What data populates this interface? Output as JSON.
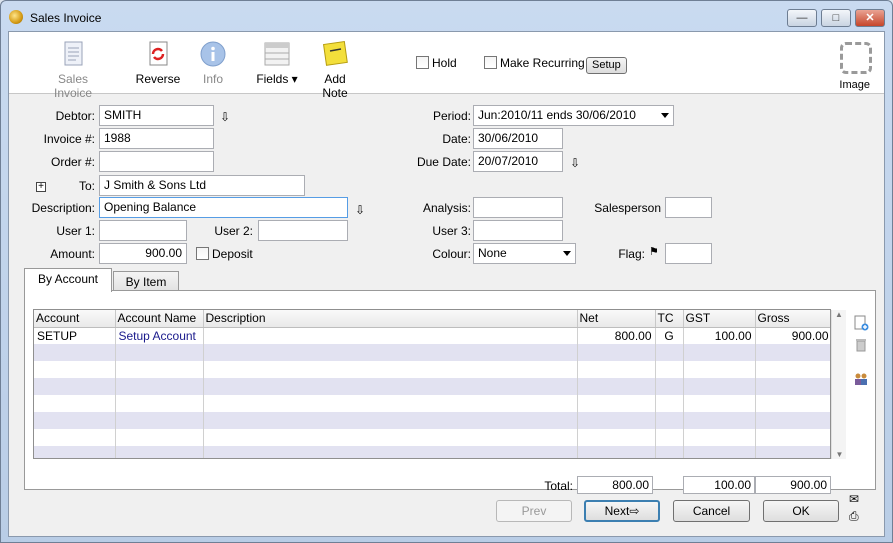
{
  "window": {
    "title": "Sales Invoice"
  },
  "toolbar": {
    "sales_invoice": "Sales Invoice",
    "reverse": "Reverse",
    "info": "Info",
    "fields": "Fields",
    "add_note": "Add Note",
    "hold": "Hold",
    "make_recurring": "Make Recurring",
    "setup": "Setup",
    "image": "Image"
  },
  "form": {
    "debtor_label": "Debtor:",
    "debtor": "SMITH",
    "invoice_label": "Invoice #:",
    "invoice": "1988",
    "order_label": "Order #:",
    "order": "",
    "to_label": "To:",
    "to": "J Smith & Sons Ltd",
    "description_label": "Description:",
    "description": "Opening Balance",
    "user1_label": "User 1:",
    "user1": "",
    "user2_label": "User 2:",
    "user2": "",
    "amount_label": "Amount:",
    "amount": "900.00",
    "deposit_label": "Deposit",
    "period_label": "Period:",
    "period": "Jun:2010/11 ends 30/06/2010",
    "date_label": "Date:",
    "date": "30/06/2010",
    "due_date_label": "Due Date:",
    "due_date": "20/07/2010",
    "analysis_label": "Analysis:",
    "analysis": "",
    "user3_label": "User 3:",
    "user3": "",
    "colour_label": "Colour:",
    "colour": "None",
    "salesperson_label": "Salesperson",
    "salesperson": "",
    "flag_label": "Flag:",
    "flag": ""
  },
  "tabs": [
    {
      "label": "By Account"
    },
    {
      "label": "By Item"
    }
  ],
  "grid": {
    "columns": [
      "Account",
      "Account Name",
      "Description",
      "Net",
      "TC",
      "GST",
      "Gross"
    ],
    "rows": [
      {
        "account": "SETUP",
        "account_name": "Setup Account",
        "description": "",
        "net": "800.00",
        "tc": "G",
        "gst": "100.00",
        "gross": "900.00"
      }
    ]
  },
  "totals": {
    "label": "Total:",
    "net": "800.00",
    "gst": "100.00",
    "gross": "900.00"
  },
  "buttons": {
    "prev": "Prev",
    "next": "Next",
    "cancel": "Cancel",
    "ok": "OK"
  },
  "colors": {
    "accent": "#3c7fb1",
    "alt_row": "#e2e2f1",
    "link": "#1a1a8c"
  }
}
